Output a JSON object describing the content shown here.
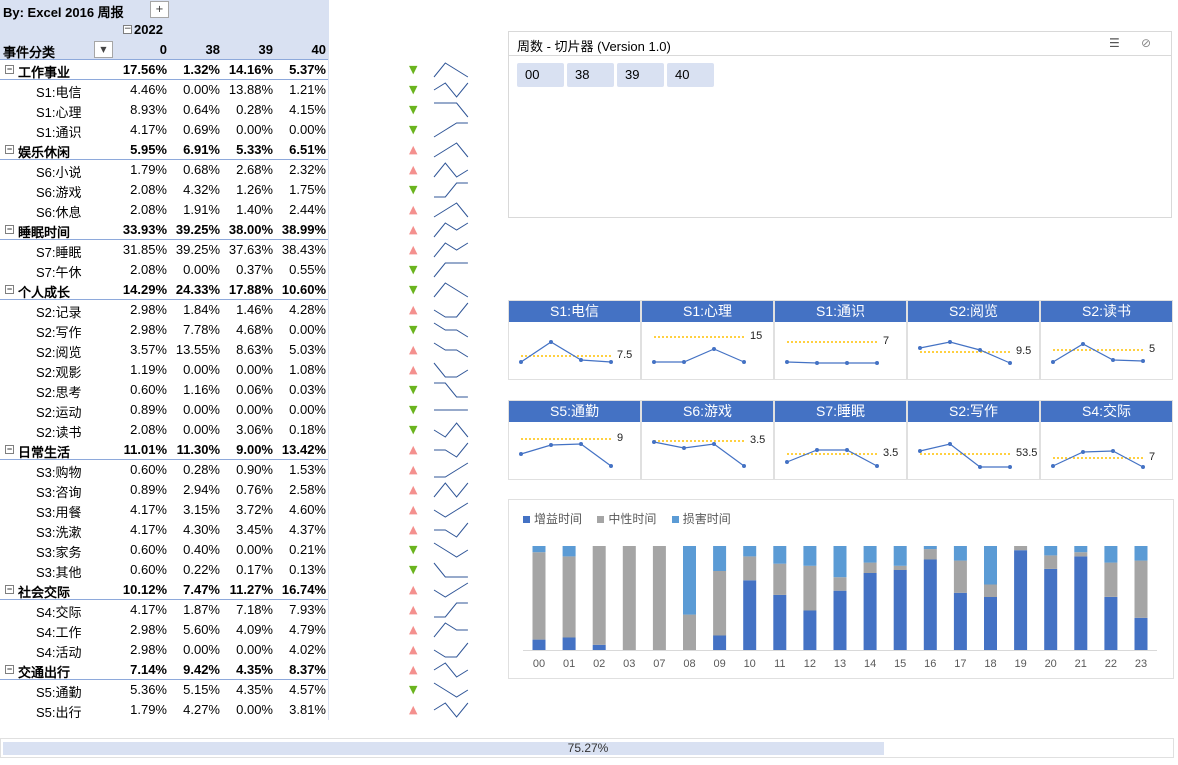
{
  "pivot": {
    "title": "By:  Excel 2016  周报",
    "filter_glyph": "+",
    "year": "2022",
    "collapse_glyph": "−",
    "row_header": "事件分类",
    "dropdown_glyph": "▼",
    "columns": [
      "0",
      "38",
      "39",
      "40"
    ],
    "rows": [
      {
        "type": "cat",
        "name": "工作事业",
        "v": [
          "17.56%",
          "1.32%",
          "14.16%",
          "5.37%"
        ],
        "trend": "down",
        "spark": [
          2,
          0,
          1,
          2
        ]
      },
      {
        "type": "sub",
        "name": "S1:电信",
        "v": [
          "4.46%",
          "0.00%",
          "13.88%",
          "1.21%"
        ],
        "trend": "down",
        "spark": [
          1,
          0,
          2,
          0
        ]
      },
      {
        "type": "sub",
        "name": "S1:心理",
        "v": [
          "8.93%",
          "0.64%",
          "0.28%",
          "4.15%"
        ],
        "trend": "down",
        "spark": [
          0,
          0,
          0,
          2
        ]
      },
      {
        "type": "sub",
        "name": "S1:通识",
        "v": [
          "4.17%",
          "0.69%",
          "0.00%",
          "0.00%"
        ],
        "trend": "down",
        "spark": [
          2,
          1,
          0,
          0
        ]
      },
      {
        "type": "cat",
        "name": "娱乐休闲",
        "v": [
          "5.95%",
          "6.91%",
          "5.33%",
          "6.51%"
        ],
        "trend": "up",
        "spark": [
          2,
          1,
          0,
          2
        ]
      },
      {
        "type": "sub",
        "name": "S6:小说",
        "v": [
          "1.79%",
          "0.68%",
          "2.68%",
          "2.32%"
        ],
        "trend": "up",
        "spark": [
          2,
          0,
          2,
          1
        ]
      },
      {
        "type": "sub",
        "name": "S6:游戏",
        "v": [
          "2.08%",
          "4.32%",
          "1.26%",
          "1.75%"
        ],
        "trend": "down",
        "spark": [
          2,
          2,
          0,
          0
        ]
      },
      {
        "type": "sub",
        "name": "S6:休息",
        "v": [
          "2.08%",
          "1.91%",
          "1.40%",
          "2.44%"
        ],
        "trend": "up",
        "spark": [
          2,
          1,
          0,
          2
        ]
      },
      {
        "type": "cat",
        "name": "睡眠时间",
        "v": [
          "33.93%",
          "39.25%",
          "38.00%",
          "38.99%"
        ],
        "trend": "up",
        "spark": [
          2,
          0,
          1,
          0
        ]
      },
      {
        "type": "sub",
        "name": "S7:睡眠",
        "v": [
          "31.85%",
          "39.25%",
          "37.63%",
          "38.43%"
        ],
        "trend": "up",
        "spark": [
          2,
          0,
          1,
          0
        ]
      },
      {
        "type": "sub",
        "name": "S7:午休",
        "v": [
          "2.08%",
          "0.00%",
          "0.37%",
          "0.55%"
        ],
        "trend": "down",
        "spark": [
          2,
          0,
          0,
          0
        ]
      },
      {
        "type": "cat",
        "name": "个人成长",
        "v": [
          "14.29%",
          "24.33%",
          "17.88%",
          "10.60%"
        ],
        "trend": "down",
        "spark": [
          2,
          0,
          1,
          2
        ]
      },
      {
        "type": "sub",
        "name": "S2:记录",
        "v": [
          "2.98%",
          "1.84%",
          "1.46%",
          "4.28%"
        ],
        "trend": "up",
        "spark": [
          1,
          2,
          2,
          0
        ]
      },
      {
        "type": "sub",
        "name": "S2:写作",
        "v": [
          "2.98%",
          "7.78%",
          "4.68%",
          "0.00%"
        ],
        "trend": "down",
        "spark": [
          0,
          1,
          1,
          2
        ]
      },
      {
        "type": "sub",
        "name": "S2:阅览",
        "v": [
          "3.57%",
          "13.55%",
          "8.63%",
          "5.03%"
        ],
        "trend": "up",
        "spark": [
          0,
          1,
          1,
          2
        ]
      },
      {
        "type": "sub",
        "name": "S2:观影",
        "v": [
          "1.19%",
          "0.00%",
          "0.00%",
          "1.08%"
        ],
        "trend": "up",
        "spark": [
          0,
          2,
          2,
          1
        ]
      },
      {
        "type": "sub",
        "name": "S2:思考",
        "v": [
          "0.60%",
          "1.16%",
          "0.06%",
          "0.03%"
        ],
        "trend": "down",
        "spark": [
          0,
          0,
          2,
          2
        ]
      },
      {
        "type": "sub",
        "name": "S2:运动",
        "v": [
          "0.89%",
          "0.00%",
          "0.00%",
          "0.00%"
        ],
        "trend": "down",
        "spark": [
          1,
          1,
          1,
          1
        ]
      },
      {
        "type": "sub",
        "name": "S2:读书",
        "v": [
          "2.08%",
          "0.00%",
          "3.06%",
          "0.18%"
        ],
        "trend": "down",
        "spark": [
          1,
          2,
          0,
          2
        ]
      },
      {
        "type": "cat",
        "name": "日常生活",
        "v": [
          "11.01%",
          "11.30%",
          "9.00%",
          "13.42%"
        ],
        "trend": "up",
        "spark": [
          1,
          1,
          2,
          0
        ]
      },
      {
        "type": "sub",
        "name": "S3:购物",
        "v": [
          "0.60%",
          "0.28%",
          "0.90%",
          "1.53%"
        ],
        "trend": "up",
        "spark": [
          2,
          2,
          1,
          0
        ]
      },
      {
        "type": "sub",
        "name": "S3:咨询",
        "v": [
          "0.89%",
          "2.94%",
          "0.76%",
          "2.58%"
        ],
        "trend": "up",
        "spark": [
          2,
          0,
          2,
          0
        ]
      },
      {
        "type": "sub",
        "name": "S3:用餐",
        "v": [
          "4.17%",
          "3.15%",
          "3.72%",
          "4.60%"
        ],
        "trend": "up",
        "spark": [
          1,
          2,
          1,
          0
        ]
      },
      {
        "type": "sub",
        "name": "S3:洗漱",
        "v": [
          "4.17%",
          "4.30%",
          "3.45%",
          "4.37%"
        ],
        "trend": "up",
        "spark": [
          1,
          1,
          2,
          0
        ]
      },
      {
        "type": "sub",
        "name": "S3:家务",
        "v": [
          "0.60%",
          "0.40%",
          "0.00%",
          "0.21%"
        ],
        "trend": "down",
        "spark": [
          0,
          1,
          2,
          1
        ]
      },
      {
        "type": "sub",
        "name": "S3:其他",
        "v": [
          "0.60%",
          "0.22%",
          "0.17%",
          "0.13%"
        ],
        "trend": "down",
        "spark": [
          0,
          2,
          2,
          2
        ]
      },
      {
        "type": "cat",
        "name": "社会交际",
        "v": [
          "10.12%",
          "7.47%",
          "11.27%",
          "16.74%"
        ],
        "trend": "up",
        "spark": [
          1,
          2,
          1,
          0
        ]
      },
      {
        "type": "sub",
        "name": "S4:交际",
        "v": [
          "4.17%",
          "1.87%",
          "7.18%",
          "7.93%"
        ],
        "trend": "up",
        "spark": [
          2,
          2,
          0,
          0
        ]
      },
      {
        "type": "sub",
        "name": "S4:工作",
        "v": [
          "2.98%",
          "5.60%",
          "4.09%",
          "4.79%"
        ],
        "trend": "up",
        "spark": [
          2,
          0,
          1,
          1
        ]
      },
      {
        "type": "sub",
        "name": "S4:活动",
        "v": [
          "2.98%",
          "0.00%",
          "0.00%",
          "4.02%"
        ],
        "trend": "up",
        "spark": [
          1,
          2,
          2,
          0
        ]
      },
      {
        "type": "cat",
        "name": "交通出行",
        "v": [
          "7.14%",
          "9.42%",
          "4.35%",
          "8.37%"
        ],
        "trend": "up",
        "spark": [
          1,
          0,
          2,
          1
        ]
      },
      {
        "type": "sub",
        "name": "S5:通勤",
        "v": [
          "5.36%",
          "5.15%",
          "4.35%",
          "4.57%"
        ],
        "trend": "down",
        "spark": [
          0,
          1,
          2,
          1
        ]
      },
      {
        "type": "sub",
        "name": "S5:出行",
        "v": [
          "1.79%",
          "4.27%",
          "0.00%",
          "3.81%"
        ],
        "trend": "up",
        "spark": [
          1,
          0,
          2,
          0
        ]
      }
    ]
  },
  "slicer": {
    "title": "周数 - 切片器  (Version 1.0)",
    "multi_select_icon": "☰",
    "clear_filter_icon": "⊘",
    "items": [
      "00",
      "38",
      "39",
      "40"
    ]
  },
  "kpis": [
    {
      "title": "S1:电信",
      "value": "7.5",
      "line": [
        1,
        3,
        1.2,
        1
      ],
      "target": 1.6
    },
    {
      "title": "S1:心理",
      "value": "15",
      "line": [
        1,
        1,
        2.3,
        1
      ],
      "target": 3.5
    },
    {
      "title": "S1:通识",
      "value": "7",
      "line": [
        1,
        0.9,
        0.9,
        0.9
      ],
      "target": 3
    },
    {
      "title": "S2:阅览",
      "value": "9.5",
      "line": [
        2.4,
        3,
        2.2,
        0.9
      ],
      "target": 2
    },
    {
      "title": "S2:读书",
      "value": "5",
      "line": [
        1,
        2.8,
        1.2,
        1.1
      ],
      "target": 2.2
    },
    {
      "title": "S5:通勤",
      "value": "9",
      "line": [
        1.8,
        2.7,
        2.8,
        0.6
      ],
      "target": 3.3
    },
    {
      "title": "S6:游戏",
      "value": "3.5",
      "line": [
        3,
        2.4,
        2.8,
        0.6
      ],
      "target": 3.1
    },
    {
      "title": "S7:睡眠",
      "value": "3.5",
      "line": [
        1,
        2.2,
        2.2,
        0.6
      ],
      "target": 1.8
    },
    {
      "title": "S2:写作",
      "value": "53.5",
      "line": [
        2.1,
        2.8,
        0.5,
        0.5
      ],
      "target": 1.8
    },
    {
      "title": "S4:交际",
      "value": "7",
      "line": [
        0.6,
        2,
        2.1,
        0.5
      ],
      "target": 1.4
    }
  ],
  "colors": {
    "header_blue": "#4472c4",
    "pivot_fill": "#d9e1f2",
    "up_arrow": "#f4908e",
    "down_arrow": "#6ab41e",
    "target_line": "#ffc000",
    "gain": "#4472c4",
    "neutral": "#a5a5a5",
    "harm": "#5b9bd5"
  },
  "chart_data": {
    "type": "bar",
    "stacked": true,
    "normalized_100": true,
    "legend_position": "top-left",
    "categories": [
      "00",
      "01",
      "02",
      "03",
      "07",
      "08",
      "09",
      "10",
      "11",
      "12",
      "13",
      "14",
      "15",
      "16",
      "17",
      "18",
      "19",
      "20",
      "21",
      "22",
      "23"
    ],
    "series": [
      {
        "name": "增益时间",
        "values": [
          0.1,
          0.12,
          0.05,
          0,
          0,
          0,
          0.14,
          0.67,
          0.53,
          0.38,
          0.57,
          0.74,
          0.77,
          0.87,
          0.55,
          0.51,
          0.96,
          0.78,
          0.9,
          0.51,
          0.31
        ]
      },
      {
        "name": "中性时间",
        "values": [
          0.84,
          0.78,
          0.95,
          1.0,
          1.0,
          0.34,
          0.62,
          0.23,
          0.3,
          0.43,
          0.13,
          0.1,
          0.04,
          0.1,
          0.31,
          0.12,
          0.04,
          0.13,
          0.04,
          0.33,
          0.55
        ]
      },
      {
        "name": "损害时间",
        "values": [
          0.06,
          0.1,
          0,
          0,
          0,
          0.66,
          0.24,
          0.1,
          0.17,
          0.19,
          0.3,
          0.16,
          0.19,
          0.03,
          0.14,
          0.37,
          0,
          0.09,
          0.06,
          0.16,
          0.14
        ]
      }
    ]
  },
  "progress": {
    "label": "75.27%",
    "value": 0.7527
  }
}
